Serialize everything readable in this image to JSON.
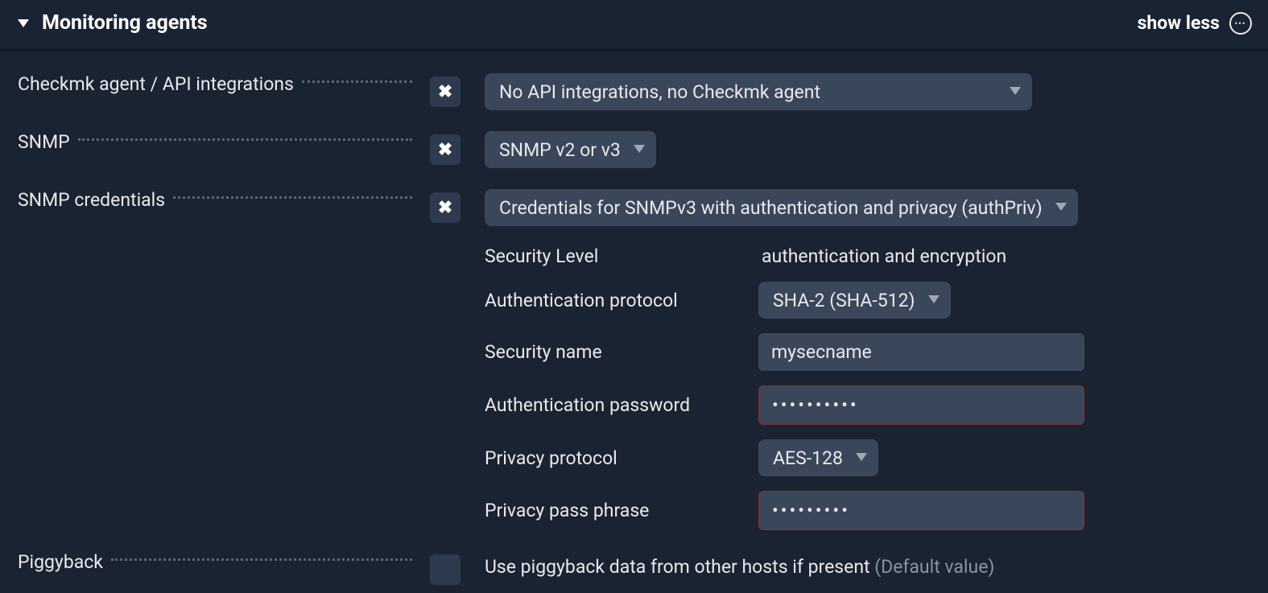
{
  "section": {
    "title": "Monitoring agents",
    "show_less": "show less"
  },
  "rows": {
    "agent": {
      "label": "Checkmk agent / API integrations",
      "value": "No API integrations, no Checkmk agent"
    },
    "snmp": {
      "label": "SNMP",
      "value": "SNMP v2 or v3"
    },
    "snmp_creds": {
      "label": "SNMP credentials",
      "value": "Credentials for SNMPv3 with authentication and privacy (authPriv)",
      "security_level_label": "Security Level",
      "security_level_value": "authentication and encryption",
      "auth_protocol_label": "Authentication protocol",
      "auth_protocol_value": "SHA-2 (SHA-512)",
      "security_name_label": "Security name",
      "security_name_value": "mysecname",
      "auth_password_label": "Authentication password",
      "auth_password_value": "••••••••••",
      "privacy_protocol_label": "Privacy protocol",
      "privacy_protocol_value": "AES-128",
      "privacy_pass_label": "Privacy pass phrase",
      "privacy_pass_value": "•••••••••"
    },
    "piggyback": {
      "label": "Piggyback",
      "value": "Use piggyback data from other hosts if present ",
      "default": "(Default value)"
    }
  }
}
